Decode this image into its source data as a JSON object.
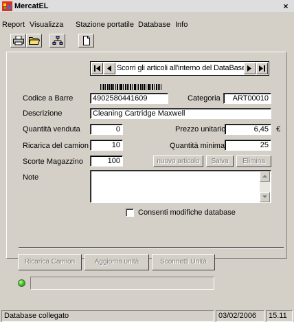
{
  "window": {
    "title": "MercatEL",
    "close_label": "×"
  },
  "menu": [
    "Report",
    "Visualizza",
    "Stazione portatile",
    "Database",
    "Info"
  ],
  "toolbar": {
    "icons": [
      "printer-icon",
      "open-folder-icon",
      "network-icon",
      "new-document-icon"
    ]
  },
  "navigator": {
    "label": "Scorri gli articoli all'interno del DataBase"
  },
  "form": {
    "barcode_label": "Codice a Barre",
    "barcode_value": "4902580441609",
    "category_label": "Categoria",
    "category_value": "ART00010",
    "description_label": "Descrizione",
    "description_value": "Cleaning Cartridge Maxwell",
    "qty_sold_label": "Quantità venduta",
    "qty_sold_value": "0",
    "unit_price_label": "Prezzo unitario",
    "unit_price_value": "6,45",
    "currency": "€",
    "truck_reload_label": "Ricarica del camion",
    "truck_reload_value": "10",
    "min_qty_label": "Quantità minima",
    "min_qty_value": "25",
    "stock_label": "Scorte Magazzino",
    "stock_value": "100",
    "notes_label": "Note",
    "new_item_button": "nuovo articolo",
    "save_button": "Salva",
    "delete_button": "Elimina",
    "allow_edit_label": "Consenti modifiche database",
    "allow_edit_checked": false
  },
  "actions": {
    "reload_truck": "Ricarica Camion",
    "update_unit": "Aggiorna unità",
    "disconnect_unit": "Sconnetti Unità"
  },
  "status": {
    "connection": "Database collegato",
    "date": "03/02/2006",
    "time": "15.11",
    "led_color": "#3fcf1f"
  }
}
